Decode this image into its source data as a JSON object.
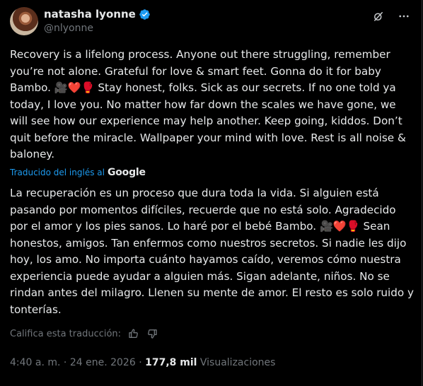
{
  "author": {
    "name": "natasha lyonne",
    "handle": "@nlyonne"
  },
  "original_text": "Recovery is a lifelong process. Anyone out there struggling, remember you’re not alone. Grateful for love & smart feet. Gonna do it for baby Bambo. 🎥❤️🥊 Stay honest, folks. Sick as our secrets. If no one told ya today, I love you. No matter how far down the scales we have gone, we will see how our experience may help another. Keep going, kiddos. Don’t quit before the miracle. Wallpaper your mind with love. Rest is all noise & baloney.",
  "translation": {
    "label": "Traducido del inglés al",
    "provider": "Google",
    "text": "La recuperación es un proceso que dura toda la vida. Si alguien está pasando por momentos difíciles, recuerde que no está solo. Agradecido por el amor y los pies sanos. Lo haré por el bebé Bambo. 🎥❤️🥊 Sean honestos, amigos. Tan enfermos como nuestros secretos. Si nadie les dijo hoy, los amo. No importa cuánto hayamos caído, veremos cómo nuestra experiencia puede ayudar a alguien más. Sigan adelante, niños. No se rindan antes del milagro. Llenen su mente de amor. El resto es solo ruido y tonterías."
  },
  "rate_translation": {
    "label": "Califica esta traducción:"
  },
  "meta": {
    "time": "4:40 a. m.",
    "separator": "·",
    "date": "24 ene. 2026",
    "views_count": "177,8 mil",
    "views_label": "Visualizaciones"
  },
  "icons": {
    "verified": "verified-badge-icon",
    "grok": "grok-icon",
    "more": "more-options-icon",
    "thumbs_up": "thumbs-up-icon",
    "thumbs_down": "thumbs-down-icon"
  },
  "colors": {
    "background": "#000000",
    "text": "#e7e9ea",
    "secondary": "#71767b",
    "accent": "#1d9bf0"
  }
}
